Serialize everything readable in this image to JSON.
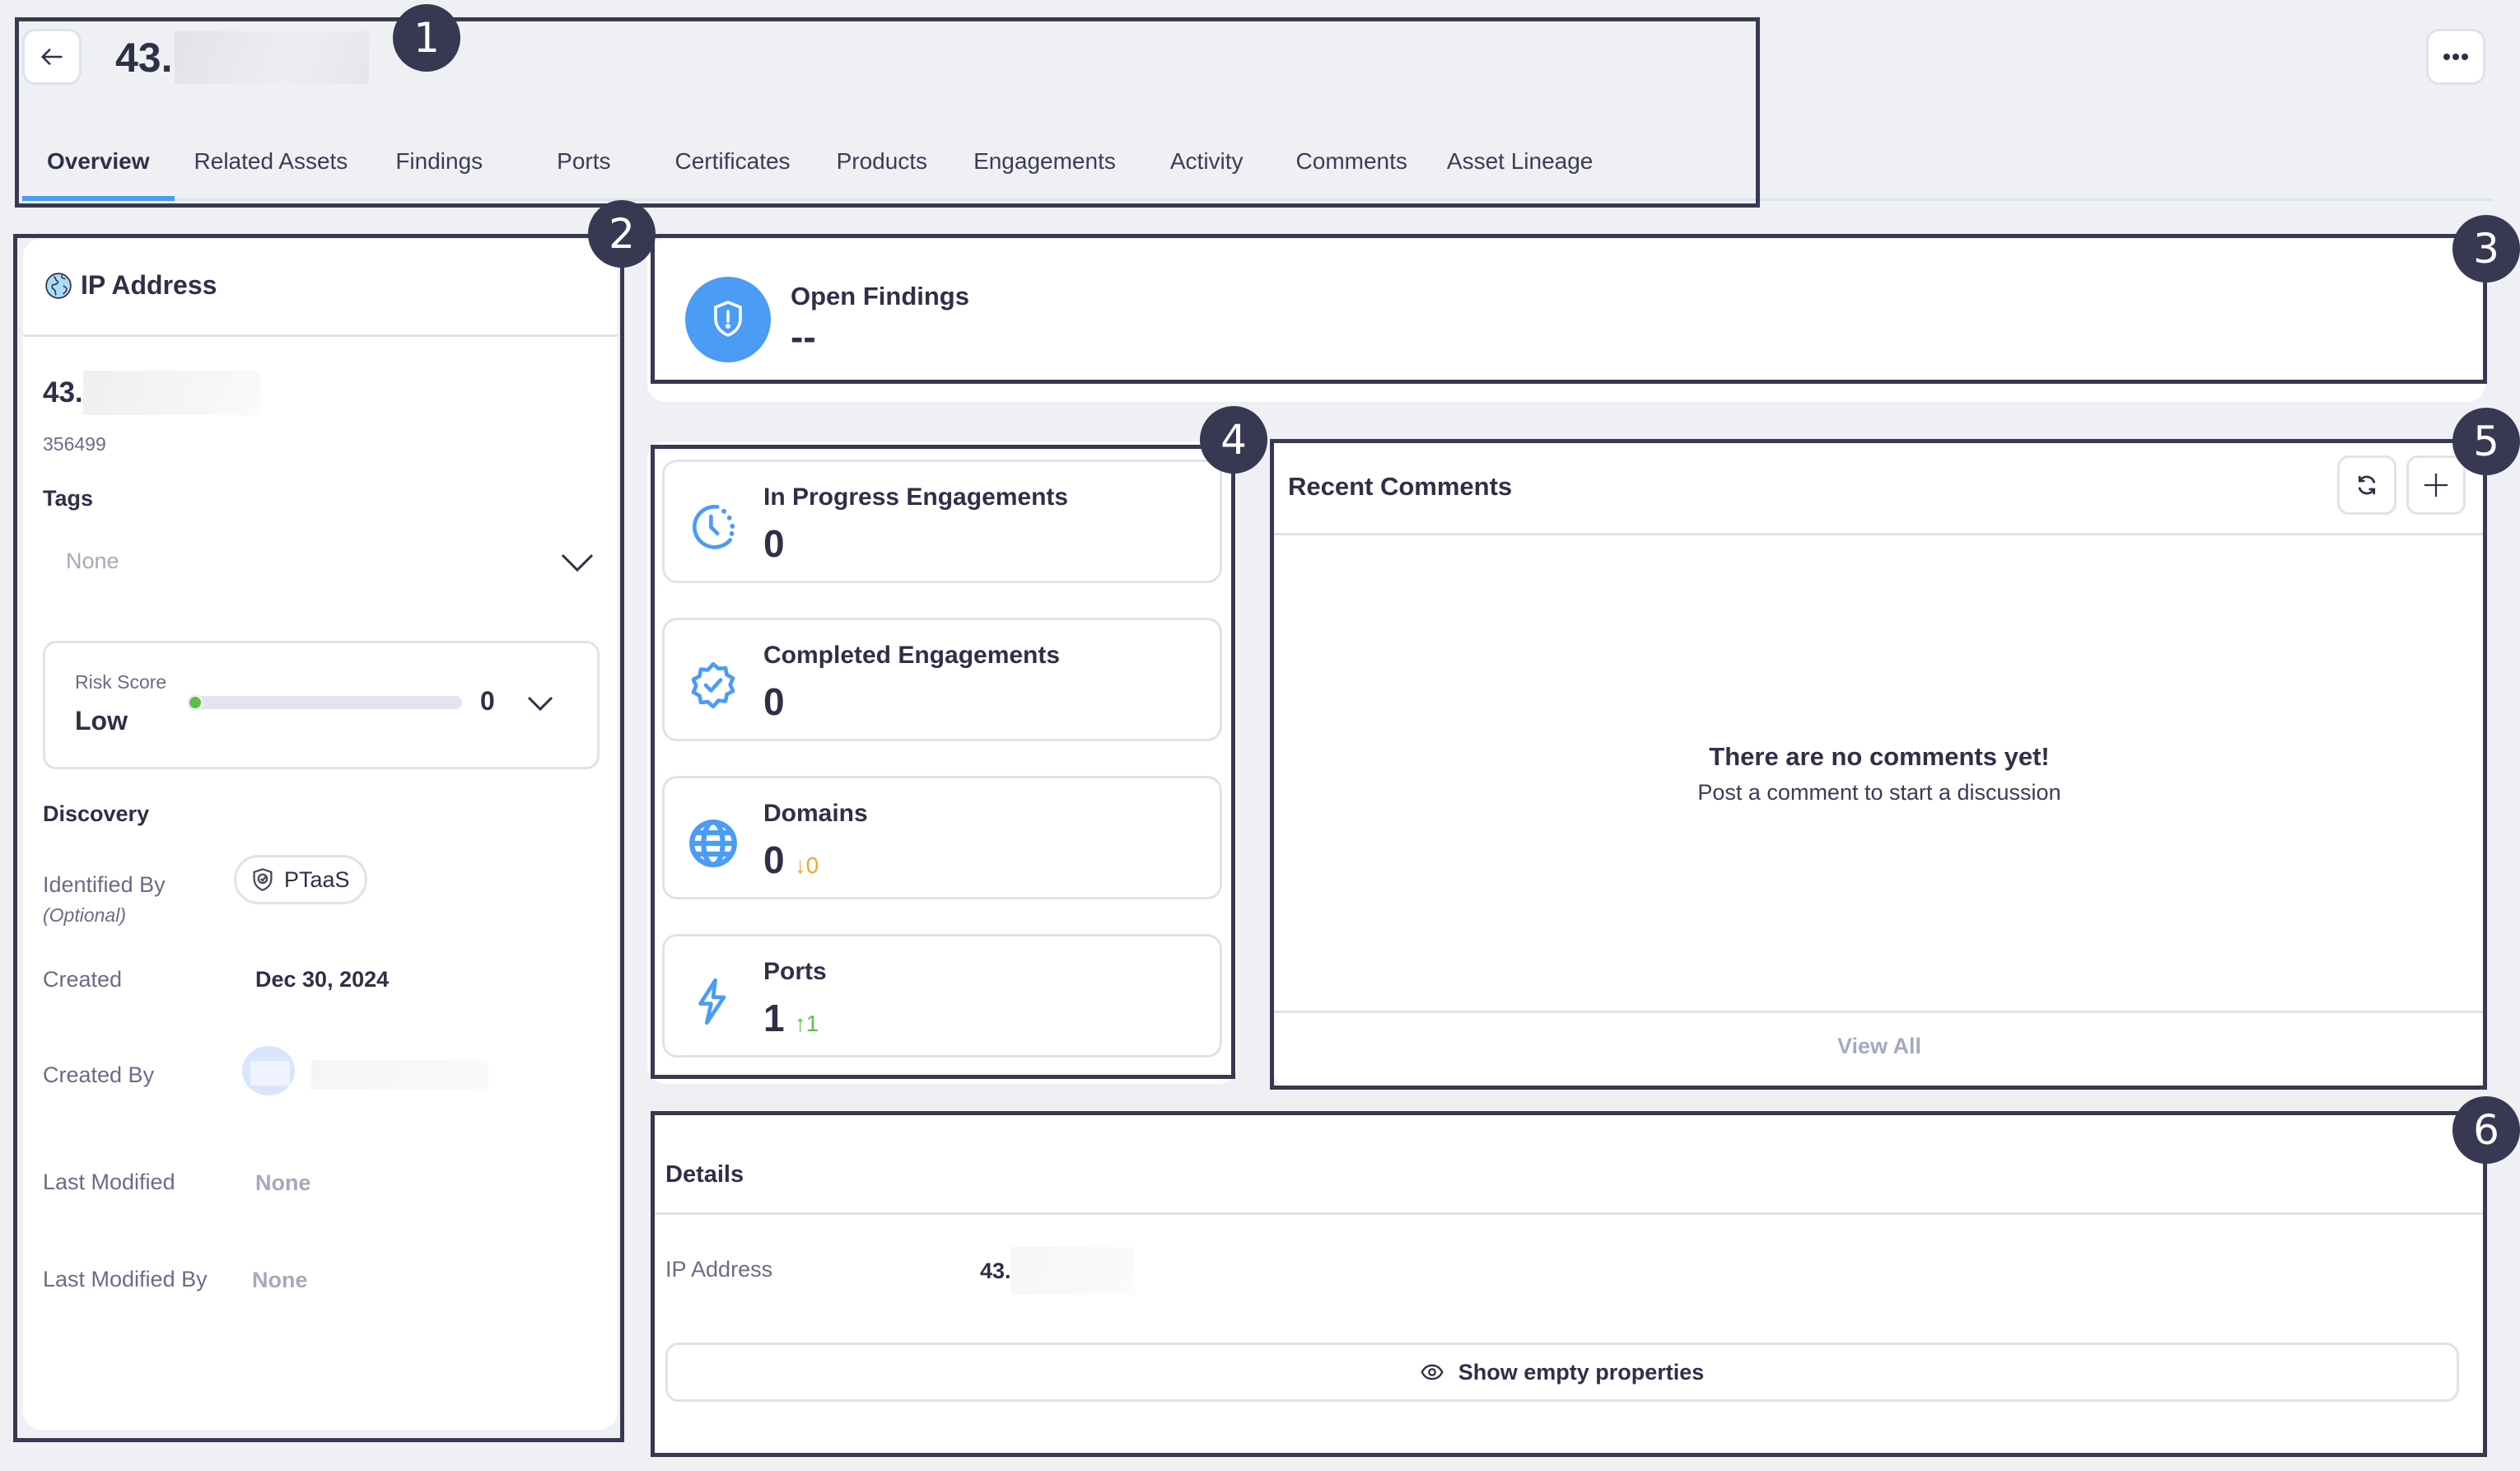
{
  "header": {
    "title_prefix": "43.",
    "back_icon": "arrow-left-icon",
    "more_icon": "more-horizontal-icon"
  },
  "tabs": [
    {
      "label": "Overview",
      "active": true
    },
    {
      "label": "Related Assets",
      "active": false
    },
    {
      "label": "Findings",
      "active": false
    },
    {
      "label": "Ports",
      "active": false
    },
    {
      "label": "Certificates",
      "active": false
    },
    {
      "label": "Products",
      "active": false
    },
    {
      "label": "Engagements",
      "active": false
    },
    {
      "label": "Activity",
      "active": false
    },
    {
      "label": "Comments",
      "active": false
    },
    {
      "label": "Asset Lineage",
      "active": false
    }
  ],
  "asset_panel": {
    "type_label": "IP Address",
    "type_icon": "globe-icon",
    "ip_prefix": "43.",
    "asset_id": "356499",
    "tags_label": "Tags",
    "tags_value": "None",
    "risk": {
      "label": "Risk Score",
      "level": "Low",
      "score": "0",
      "score_value": 0,
      "indicator_color": "#5cbf45"
    },
    "discovery_label": "Discovery",
    "identified_by_label": "Identified By",
    "identified_by_optional": "(Optional)",
    "identified_by_value": "PTaaS",
    "created_label": "Created",
    "created_value": "Dec 30, 2024",
    "created_by_label": "Created By",
    "last_modified_label": "Last Modified",
    "last_modified_value": "None",
    "last_modified_by_label": "Last Modified By",
    "last_modified_by_value": "None"
  },
  "open_findings": {
    "label": "Open Findings",
    "value": "--",
    "icon_color": "#4a9cf5"
  },
  "stats": [
    {
      "title": "In Progress Engagements",
      "value": "0",
      "delta": "",
      "icon": "clock-progress-icon"
    },
    {
      "title": "Completed Engagements",
      "value": "0",
      "delta": "",
      "icon": "badge-check-icon"
    },
    {
      "title": "Domains",
      "value": "0",
      "delta": "↓0",
      "delta_color": "#f0a830",
      "icon": "globe-grid-icon"
    },
    {
      "title": "Ports",
      "value": "1",
      "delta": "↑1",
      "delta_color": "#5cbf45",
      "icon": "lightning-icon"
    }
  ],
  "recent_comments": {
    "title": "Recent Comments",
    "empty_title": "There are no comments yet!",
    "empty_subtitle": "Post a comment to start a discussion",
    "view_all": "View All"
  },
  "details": {
    "title": "Details",
    "rows": [
      {
        "label": "IP Address",
        "value_prefix": "43."
      }
    ],
    "show_empty_label": "Show empty properties"
  },
  "annotations": [
    "1",
    "2",
    "3",
    "4",
    "5",
    "6"
  ]
}
